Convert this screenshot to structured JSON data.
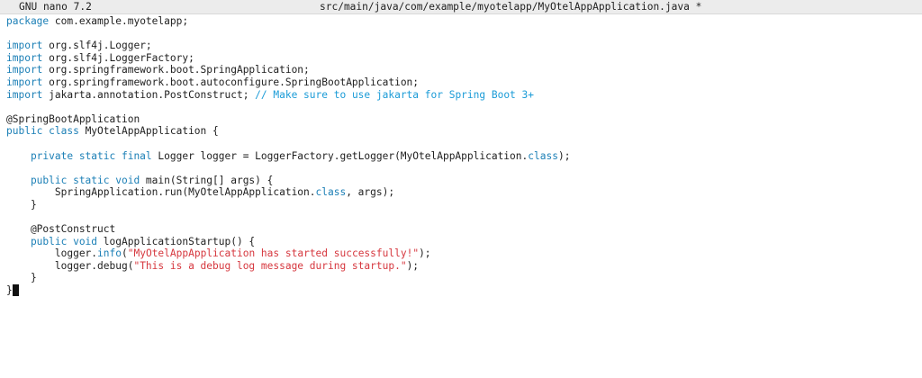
{
  "titlebar": {
    "app": "GNU nano 7.2",
    "file": "src/main/java/com/example/myotelapp/MyOtelAppApplication.java *"
  },
  "theme": {
    "keyword": "#1b7fb6",
    "string": "#d6373e",
    "comment": "#1a9bd7",
    "text": "#1e1e1e"
  },
  "code": [
    {
      "segments": [
        {
          "text": "package",
          "style": "kw"
        },
        {
          "text": " com.example.myotelapp;"
        }
      ]
    },
    {
      "segments": []
    },
    {
      "segments": [
        {
          "text": "import",
          "style": "kw"
        },
        {
          "text": " org.slf4j.Logger;"
        }
      ]
    },
    {
      "segments": [
        {
          "text": "import",
          "style": "kw"
        },
        {
          "text": " org.slf4j.LoggerFactory;"
        }
      ]
    },
    {
      "segments": [
        {
          "text": "import",
          "style": "kw"
        },
        {
          "text": " org.springframework.boot.SpringApplication;"
        }
      ]
    },
    {
      "segments": [
        {
          "text": "import",
          "style": "kw"
        },
        {
          "text": " org.springframework.boot.autoconfigure.SpringBootApplication;"
        }
      ]
    },
    {
      "segments": [
        {
          "text": "import",
          "style": "kw"
        },
        {
          "text": " jakarta.annotation.PostConstruct; "
        },
        {
          "text": "// Make sure to use jakarta for Spring Boot 3+",
          "style": "cmt"
        }
      ]
    },
    {
      "segments": []
    },
    {
      "segments": [
        {
          "text": "@SpringBootApplication"
        }
      ]
    },
    {
      "segments": [
        {
          "text": "public class",
          "style": "kw"
        },
        {
          "text": " MyOtelAppApplication {"
        }
      ]
    },
    {
      "segments": []
    },
    {
      "segments": [
        {
          "text": "    private static final",
          "style": "kw"
        },
        {
          "text": " Logger logger = LoggerFactory.getLogger(MyOtelAppApplication."
        },
        {
          "text": "class",
          "style": "kw"
        },
        {
          "text": ");"
        }
      ]
    },
    {
      "segments": []
    },
    {
      "segments": [
        {
          "text": "    public static void",
          "style": "kw"
        },
        {
          "text": " main(String[] args) {"
        }
      ]
    },
    {
      "segments": [
        {
          "text": "        SpringApplication.run(MyOtelAppApplication."
        },
        {
          "text": "class",
          "style": "kw"
        },
        {
          "text": ", args);"
        }
      ]
    },
    {
      "segments": [
        {
          "text": "    }"
        }
      ]
    },
    {
      "segments": []
    },
    {
      "segments": [
        {
          "text": "    @PostConstruct"
        }
      ]
    },
    {
      "segments": [
        {
          "text": "    public void",
          "style": "kw"
        },
        {
          "text": " logApplicationStartup() {"
        }
      ]
    },
    {
      "segments": [
        {
          "text": "        logger."
        },
        {
          "text": "info",
          "style": "kw"
        },
        {
          "text": "("
        },
        {
          "text": "\"MyOtelAppApplication has started successfully!\"",
          "style": "str"
        },
        {
          "text": ");"
        }
      ]
    },
    {
      "segments": [
        {
          "text": "        logger.debug("
        },
        {
          "text": "\"This is a debug log message during startup.\"",
          "style": "str"
        },
        {
          "text": ");"
        }
      ]
    },
    {
      "segments": [
        {
          "text": "    }"
        }
      ]
    },
    {
      "segments": [
        {
          "text": "}"
        }
      ],
      "cursor": true
    }
  ]
}
